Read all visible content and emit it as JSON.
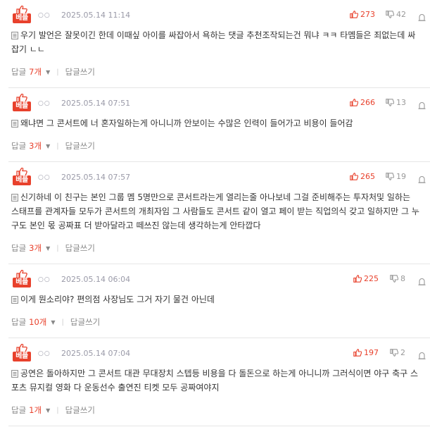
{
  "colors": {
    "accent": "#e8412c",
    "meta": "#9a9aa8",
    "divider": "#e6e6e6"
  },
  "icons": {
    "best_badge": "thumbs-up-best-badge",
    "like": "thumbs-up-icon",
    "dislike": "thumbs-down-icon",
    "report": "report-icon",
    "document": "document-icon",
    "expand": "caret-down-icon"
  },
  "comments": [
    {
      "badge": "베플",
      "author_mask": "○○",
      "date": "2025.05.14 11:14",
      "likes": "273",
      "dislikes": "42",
      "text": "우기 발언은 잘못이긴 한데 이때싶 아이를 싸잡아서 욕하는 댓글 추천조작되는건 뭐냐 ㅋㅋ 타멤들은 죄없는데 싸잡기 ㄴㄴ",
      "reply_label": "답글",
      "reply_count": "7개",
      "write_reply": "답글쓰기"
    },
    {
      "badge": "베플",
      "author_mask": "○○",
      "date": "2025.05.14 07:51",
      "likes": "266",
      "dislikes": "13",
      "text": "왜냐면 그 콘서트에 너 혼자일하는게 아니니까 안보이는 수많은 인력이 들어가고 비용이 들어감",
      "reply_label": "답글",
      "reply_count": "3개",
      "write_reply": "답글쓰기"
    },
    {
      "badge": "베플",
      "author_mask": "○○",
      "date": "2025.05.14 07:57",
      "likes": "265",
      "dislikes": "19",
      "text": "신기하네 이 친구는 본인 그룹 멤 5명만으로 콘서트라는게 열리는줄 아나보네 그걸 준비해주는 투자처및 일하는 스태프를 관계자들 모두가 콘서트의 개최자임 그 사람들도 콘서트 같이 열고 페이 받는 직업의식 갖고 일하지만 그 누구도 본인 몫 공짜표 더 받아달라고 떼쓰진 않는데 생각하는게 안타깝다",
      "reply_label": "답글",
      "reply_count": "3개",
      "write_reply": "답글쓰기"
    },
    {
      "badge": "베플",
      "author_mask": "○○",
      "date": "2025.05.14 06:04",
      "likes": "225",
      "dislikes": "8",
      "text": "이게 뭔소리야? 편의점 사장님도 그거 자기 물건 아닌데",
      "reply_label": "답글",
      "reply_count": "10개",
      "write_reply": "답글쓰기"
    },
    {
      "badge": "베플",
      "author_mask": "○○",
      "date": "2025.05.14 07:04",
      "likes": "197",
      "dislikes": "2",
      "text": "공연은 돌아하지만 그 콘서트 대관 무대장치 스텝등 비용을 다 돌돈으로 하는게 아니니까 그러식이면 야구 축구 스포츠 뮤지컬 영화 다 운동선수 출연진 티켓 모두 공짜여야지",
      "reply_label": "답글",
      "reply_count": "1개",
      "write_reply": "답글쓰기"
    }
  ]
}
